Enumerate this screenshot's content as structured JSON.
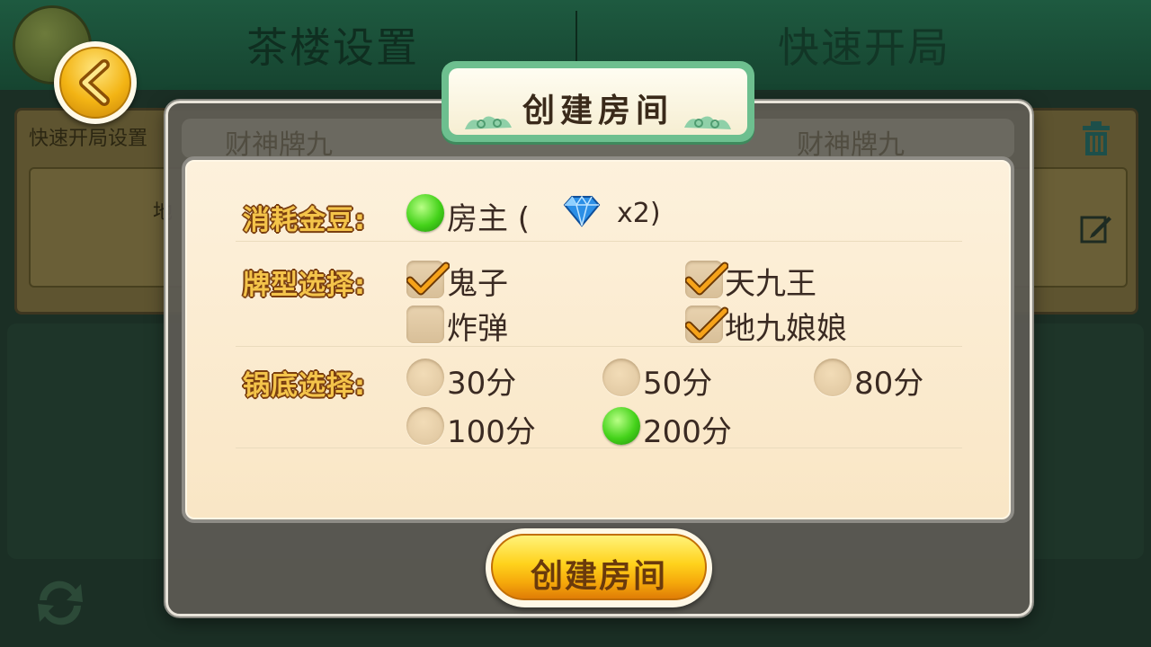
{
  "background": {
    "tabs": [
      "茶楼设置",
      "快速开局"
    ],
    "panel_label": "快速开局设置",
    "panel_tag": "地",
    "ghost_left": "财神牌九",
    "ghost_right": "财神牌九"
  },
  "dialog": {
    "title": "创建房间",
    "cost": {
      "label": "消耗金豆:",
      "option": "房主 (",
      "multiplier": "x2)",
      "selected": true
    },
    "card_types": {
      "label": "牌型选择:",
      "options": [
        {
          "label": "鬼子",
          "checked": true
        },
        {
          "label": "天九王",
          "checked": true
        },
        {
          "label": "炸弹",
          "checked": false
        },
        {
          "label": "地九娘娘",
          "checked": true
        }
      ]
    },
    "pot_base": {
      "label": "锅底选择:",
      "options": [
        {
          "label": "30分",
          "selected": false
        },
        {
          "label": "50分",
          "selected": false
        },
        {
          "label": "80分",
          "selected": false
        },
        {
          "label": "100分",
          "selected": false
        },
        {
          "label": "200分",
          "selected": true
        }
      ]
    },
    "create_button": "创建房间"
  },
  "icons": {
    "back": "chevron-left-icon",
    "diamond": "diamond-icon",
    "check": "checkmark-icon",
    "trash": "trash-icon",
    "edit": "edit-icon",
    "refresh": "refresh-icon"
  },
  "colors": {
    "accent_gold": "#f3b414",
    "selected_green": "#44d21a",
    "label_gold": "#f4c44a",
    "title_frame_green": "#6dbf8f"
  }
}
